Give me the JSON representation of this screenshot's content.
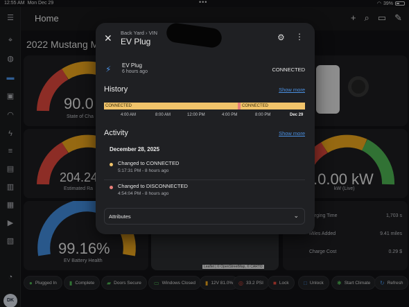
{
  "status_bar": {
    "time": "12:55 AM",
    "date": "Mon Dec 29",
    "battery": "39%"
  },
  "header": {
    "title": "Home"
  },
  "background": {
    "vehicle_title": "2022 Mustang Ma",
    "gauges": {
      "charge_value": "90.0",
      "charge_label": "State of Cha",
      "range_value": "204.24",
      "range_label": "Estimated Ra",
      "power_value": ".0.00 kW",
      "power_label": "kW (Live)",
      "battery_value": "99.16%",
      "battery_label": "EV Battery Health"
    },
    "stats": [
      {
        "label": "harging Time",
        "value": "1,703 s"
      },
      {
        "label": "Miles Added",
        "value": "9.41 miles"
      },
      {
        "label": "Charge Cost",
        "value": "0.29 $"
      }
    ],
    "map_attribution": "Leaflet | © OpenStreetMap, © CARTO"
  },
  "chips": [
    {
      "label": "Plugged In",
      "icon": "plug-icon"
    },
    {
      "label": "Complete",
      "icon": "battery-icon"
    },
    {
      "label": "Doors Secure",
      "icon": "car-door-icon"
    },
    {
      "label": "Windows Closed",
      "icon": "window-icon"
    },
    {
      "label": "12V 81.0%",
      "icon": "battery-12v-icon"
    },
    {
      "label": "33.2 PSI",
      "icon": "tire-icon"
    },
    {
      "label": "Lock",
      "icon": "lock-icon"
    },
    {
      "label": "Unlock",
      "icon": "unlock-icon"
    },
    {
      "label": "Start Climate",
      "icon": "climate-icon"
    },
    {
      "label": "Refresh",
      "icon": "refresh-icon"
    }
  ],
  "user": {
    "initials": "DK"
  },
  "dialog": {
    "breadcrumb": "Back Yard › VIN",
    "title": "EV Plug",
    "entity": {
      "name": "EV Plug",
      "time": "6 hours ago",
      "state": "CONNECTED"
    },
    "history": {
      "title": "History",
      "link": "Show more",
      "segments": [
        {
          "label": "CONNECTED",
          "color": "#f0c36a"
        },
        {
          "label": "",
          "color": "#e8807a"
        },
        {
          "label": "CONNECTED",
          "color": "#f0c36a"
        }
      ],
      "axis": [
        "4:00 AM",
        "8:00 AM",
        "12:00 PM",
        "4:00 PM",
        "8:00 PM",
        "Dec 29"
      ]
    },
    "activity": {
      "title": "Activity",
      "link": "Show more",
      "date": "December 28, 2025",
      "items": [
        {
          "main": "Changed to CONNECTED",
          "sub": "5:17:31 PM - 8 hours ago",
          "color": "#f0c36a"
        },
        {
          "main": "Changed to DISCONNECTED",
          "sub": "4:54:04 PM - 8 hours ago",
          "color": "#e8807a"
        }
      ]
    },
    "attributes_label": "Attributes"
  },
  "colors": {
    "accent": "#4a90e2",
    "connected": "#f0c36a",
    "disconnected": "#e8807a"
  }
}
